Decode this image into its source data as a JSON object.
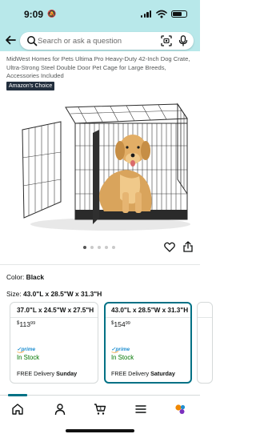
{
  "status_bar": {
    "time": "9:09"
  },
  "search": {
    "placeholder": "Search or ask a question"
  },
  "product": {
    "title": "MidWest Homes for Pets Ultima Pro Heavy-Duty 42-Inch Dog Crate, Ultra-Strong Steel Double Door Pet Cage for Large Breeds, Accessories Included",
    "badge": "Amazon's Choice",
    "image_carousel": {
      "total": 5,
      "active_index": 0
    }
  },
  "variations": {
    "color_label": "Color:",
    "color_value": "Black",
    "size_label": "Size:",
    "size_value": "43.0\"L x 28.5\"W x 31.3\"H",
    "options": [
      {
        "dims": "37.0\"L x 24.5\"W x 27.5\"H",
        "price_symbol": "$",
        "price_whole": "113",
        "price_fraction": "99",
        "prime": "prime",
        "stock": "In Stock",
        "delivery_prefix": "FREE Delivery",
        "delivery_day": "Sunday",
        "selected": false
      },
      {
        "dims": "43.0\"L x 28.5\"W x 31.3\"H",
        "price_symbol": "$",
        "price_whole": "154",
        "price_fraction": "99",
        "prime": "prime",
        "stock": "In Stock",
        "delivery_prefix": "FREE Delivery",
        "delivery_day": "Saturday",
        "selected": true
      },
      {
        "dims": "",
        "selected": false
      }
    ]
  },
  "bottom_nav": {
    "items": [
      "home-icon",
      "account-icon",
      "cart-icon",
      "menu-icon",
      "rufus-icon"
    ],
    "active": "home-icon"
  },
  "colors": {
    "header_bg": "#b8e8ea",
    "accent_teal": "#007185",
    "stock_green": "#007600",
    "prime_blue": "#1f8fd1",
    "badge_bg": "#232f3e"
  }
}
